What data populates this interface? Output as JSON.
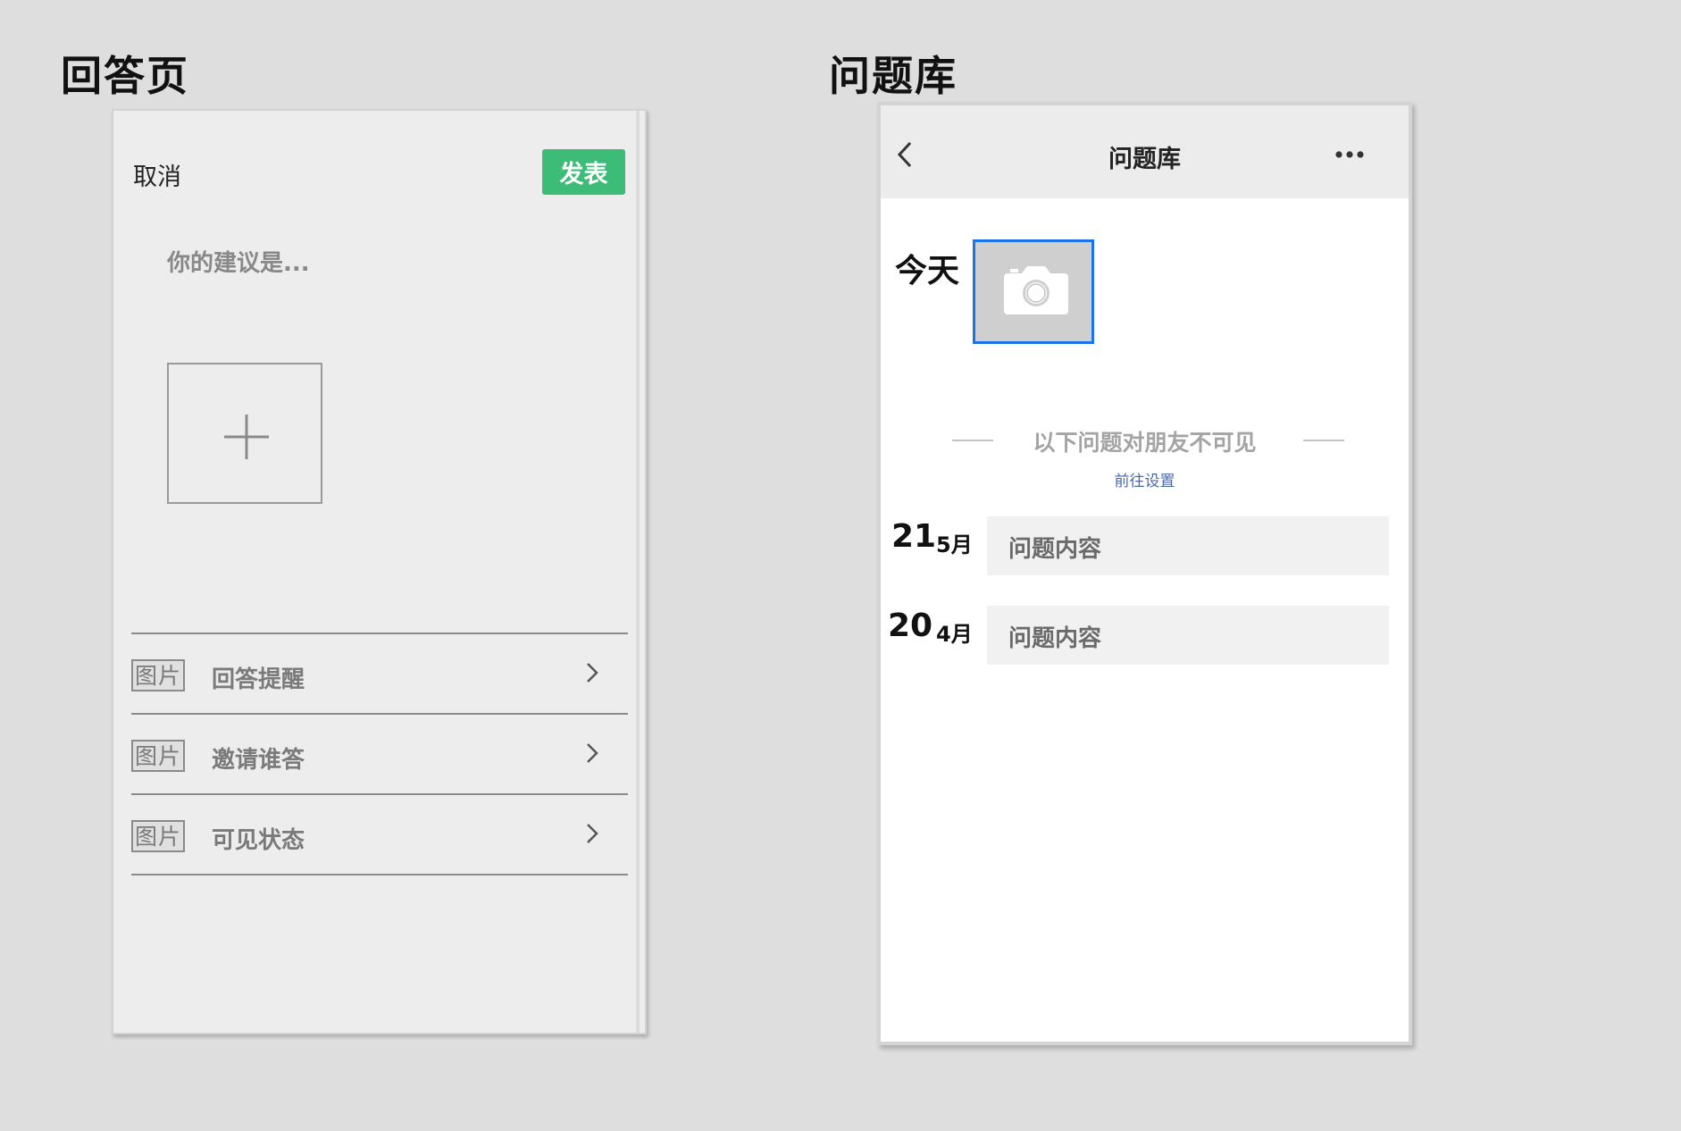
{
  "sections": {
    "answer_title": "回答页",
    "bank_title": "问题库"
  },
  "answer_page": {
    "cancel_label": "取消",
    "publish_label": "发表",
    "publish_color": "#3cbc77",
    "input_placeholder": "你的建议是...",
    "add_image_icon": "plus-icon",
    "options": [
      {
        "tag": "图片",
        "label": "回答提醒",
        "icon": "chevron-right-icon"
      },
      {
        "tag": "图片",
        "label": "邀请谁答",
        "icon": "chevron-right-icon"
      },
      {
        "tag": "图片",
        "label": "可见状态",
        "icon": "chevron-right-icon"
      }
    ]
  },
  "question_bank": {
    "header": {
      "title": "问题库",
      "back_icon": "back-arrow-icon",
      "more_icon": "more-dots-icon"
    },
    "today_label": "今天",
    "camera_icon": "camera-icon",
    "selection_color": "#1a73e8",
    "privacy_notice": "以下问题对朋友不可见",
    "settings_link": "前往设置",
    "questions": [
      {
        "day": "21",
        "month": "5月",
        "content": "问题内容"
      },
      {
        "day": "20",
        "month": "4月",
        "content": "问题内容"
      }
    ]
  }
}
